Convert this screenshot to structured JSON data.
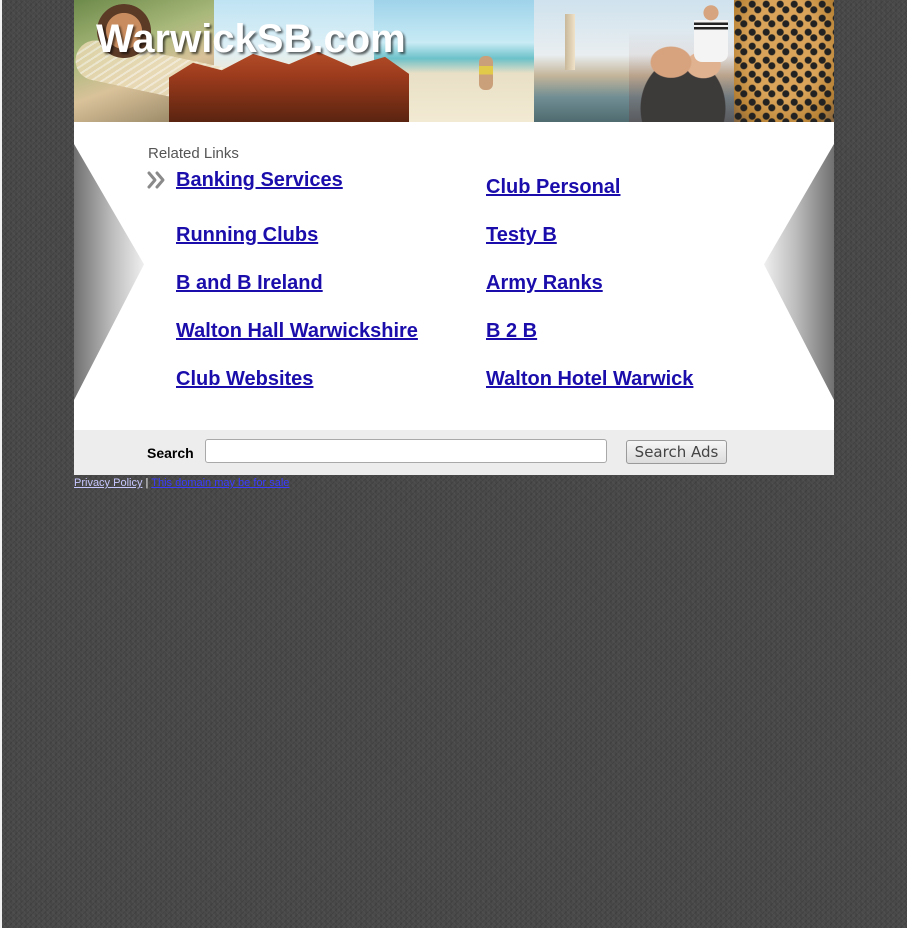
{
  "site": {
    "title": "WarwickSB.com"
  },
  "related": {
    "heading": "Related Links",
    "links_col1": [
      "Banking Services",
      "Running Clubs",
      "B and B Ireland",
      "Walton Hall Warwickshire",
      "Club Websites"
    ],
    "links_col2": [
      "Club Personal",
      "Testy B",
      "Army Ranks",
      "B 2 B",
      "Walton Hotel Warwick"
    ]
  },
  "search": {
    "label": "Search",
    "value": "",
    "button_label": "Search Ads"
  },
  "footer": {
    "privacy_label": "Privacy Policy",
    "separator": "|",
    "domain_sale_label": "This domain may be for sale"
  },
  "colors": {
    "link": "#1a0dab",
    "background": "#4a4a4a",
    "search_bar": "#ededed"
  }
}
